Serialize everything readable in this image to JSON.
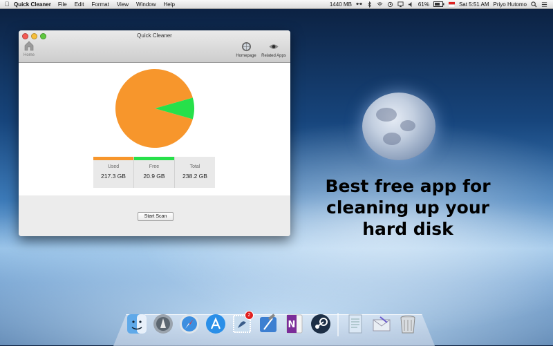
{
  "menubar": {
    "app_name": "Quick Cleaner",
    "menus": [
      "File",
      "Edit",
      "Format",
      "View",
      "Window",
      "Help"
    ],
    "memory": "1440 MB",
    "battery": "61%",
    "clock": "Sat 5:51 AM",
    "user": "Priyo Hutomo"
  },
  "window": {
    "title": "Quick Cleaner",
    "toolbar": {
      "home_label": "Home",
      "homepage_label": "Homepage",
      "related_label": "Related Apps"
    },
    "disk": {
      "used_label": "Used",
      "used_value": "217.3 GB",
      "used_gb": 217.3,
      "free_label": "Free",
      "free_value": "20.9 GB",
      "free_gb": 20.9,
      "total_label": "Total",
      "total_value": "238.2 GB",
      "used_color": "#f7962c",
      "free_color": "#27e04a"
    },
    "start_scan_label": "Start Scan"
  },
  "tagline": [
    "Best free app for",
    "cleaning up your",
    "hard disk"
  ],
  "dock": {
    "icons": [
      "finder-icon",
      "launchpad-icon",
      "safari-icon",
      "app-store-icon",
      "mail-stamp-icon",
      "xcode-icon",
      "onenote-icon",
      "steam-icon",
      "textedit-icon",
      "mail-icon",
      "trash-icon"
    ],
    "mail_badge": "2"
  }
}
